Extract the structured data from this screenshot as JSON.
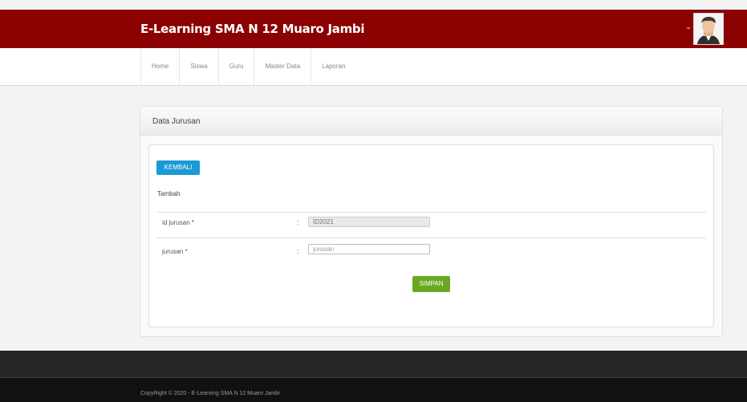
{
  "header": {
    "brand": "E-Learning SMA N 12 Muaro Jambi",
    "brand_color": "#8b0000"
  },
  "nav": {
    "items": [
      "Home",
      "Siswa",
      "Guru",
      "Master Data",
      "Laporan"
    ]
  },
  "panel": {
    "title": "Data Jurusan"
  },
  "form": {
    "back_label": "KEMBALI",
    "subtitle": "Tambah",
    "fields": [
      {
        "label": "id jurusan *",
        "value": "ID2021",
        "placeholder": ""
      },
      {
        "label": "jurusan *",
        "value": "",
        "placeholder": "jurusan"
      }
    ],
    "colon": ":",
    "save_label": "SIMPAN"
  },
  "footer": {
    "copyright": "CopyRight © 2020 - E-Learning SMA N 12 Muaro Jambi"
  },
  "colors": {
    "primary_button": "#1a9ad6",
    "success_button": "#6aa823"
  }
}
